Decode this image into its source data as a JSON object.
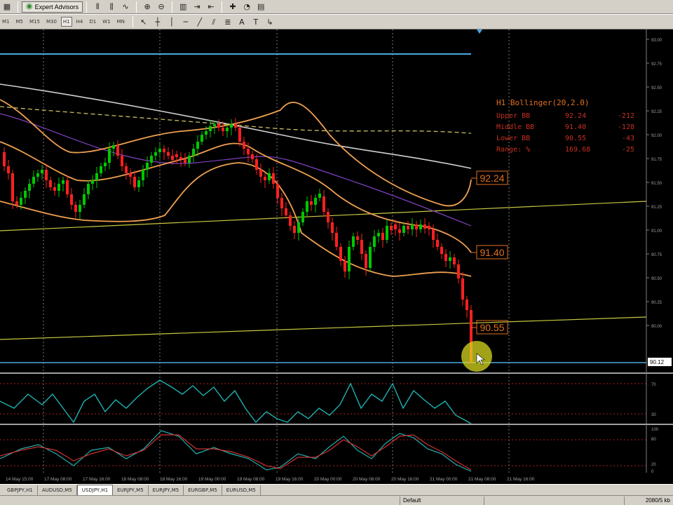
{
  "toolbar_top": {
    "items": [
      {
        "name": "new-chart-icon",
        "glyph": "▦"
      },
      {
        "name": "sep"
      },
      {
        "name": "expert-advisors-button",
        "label": "Expert Advisors",
        "glyph": "◉"
      },
      {
        "name": "sep"
      },
      {
        "name": "bar-chart-icon",
        "glyph": "⫴"
      },
      {
        "name": "candlestick-icon",
        "glyph": "⫼"
      },
      {
        "name": "line-chart-icon",
        "glyph": "∿"
      },
      {
        "name": "sep"
      },
      {
        "name": "zoom-in-icon",
        "glyph": "⊕"
      },
      {
        "name": "zoom-out-icon",
        "glyph": "⊖"
      },
      {
        "name": "sep"
      },
      {
        "name": "tile-windows-icon",
        "glyph": "▥"
      },
      {
        "name": "autoscroll-icon",
        "glyph": "⇥"
      },
      {
        "name": "chart-shift-icon",
        "glyph": "⇤"
      },
      {
        "name": "sep"
      },
      {
        "name": "indicators-icon",
        "glyph": "✚"
      },
      {
        "name": "periods-icon",
        "glyph": "◔"
      },
      {
        "name": "templates-icon",
        "glyph": "▤"
      }
    ]
  },
  "timeframes": [
    "M1",
    "M5",
    "M15",
    "M30",
    "H1",
    "H4",
    "D1",
    "W1",
    "MN"
  ],
  "active_timeframe": "H1",
  "drawing_tools": [
    {
      "name": "cursor-icon",
      "glyph": "↖"
    },
    {
      "name": "crosshair-icon",
      "glyph": "┼"
    },
    {
      "name": "vertical-line-icon",
      "glyph": "│"
    },
    {
      "name": "horizontal-line-icon",
      "glyph": "─"
    },
    {
      "name": "trendline-icon",
      "glyph": "╱"
    },
    {
      "name": "equidistant-channel-icon",
      "glyph": "⫽"
    },
    {
      "name": "fibonacci-icon",
      "glyph": "≣"
    },
    {
      "name": "text-icon",
      "glyph": "A"
    },
    {
      "name": "text-label-icon",
      "glyph": "T"
    },
    {
      "name": "arrows-icon",
      "glyph": "↳"
    }
  ],
  "chart": {
    "symbol_tab": "USDJPY,H1",
    "indicator_title": "H1 Bollinger(20,2.0)",
    "indicator_rows": [
      {
        "label": "Upper BB",
        "value": "92.24",
        "pips": "-212"
      },
      {
        "label": "Middle BB",
        "value": "91.40",
        "pips": "-128"
      },
      {
        "label": "Lower BB",
        "value": "90.55",
        "pips": "-43"
      },
      {
        "label": "Range: %",
        "value": "169.68",
        "pips": "-25"
      }
    ],
    "band_labels": {
      "upper": "92.24",
      "middle": "91.40",
      "lower": "90.55"
    },
    "price_axis": [
      "93.00",
      "92.75",
      "92.50",
      "92.25",
      "92.00",
      "91.75",
      "91.50",
      "91.25",
      "91.00",
      "90.75",
      "90.50",
      "90.25",
      "90.00"
    ],
    "current_price": "90.12",
    "rsi_axis": [
      "70",
      "30"
    ],
    "stoch_axis": [
      "100",
      "80",
      "20",
      "0"
    ],
    "time_axis": [
      "14 May 15:00",
      "17 May 08:00",
      "17 May 16:00",
      "18 May 08:00",
      "18 May 16:00",
      "19 May 00:00",
      "19 May 08:00",
      "19 May 16:00",
      "20 May 00:00",
      "20 May 08:00",
      "20 May 16:00",
      "21 May 00:00",
      "21 May 08:00",
      "21 May 16:00"
    ],
    "colors": {
      "bull": "#00c800",
      "bear": "#ff2020",
      "bollinger": "#f0a050",
      "trend": "#c8c840",
      "hline": "#4aa8e0",
      "label": "#e07020",
      "osc1": "#20b0b0",
      "osc2": "#d03030"
    }
  },
  "tabs": [
    "GBPJPY,H1",
    "AUDUSD,M5",
    "USDJPY,H1",
    "EURJPY,M5",
    "EURJPY,M5",
    "EURGBP,M5",
    "EURUSD,M5"
  ],
  "active_tab": "USDJPY,H1",
  "status": {
    "profile": "Default",
    "traffic": "2080/5 kb"
  }
}
